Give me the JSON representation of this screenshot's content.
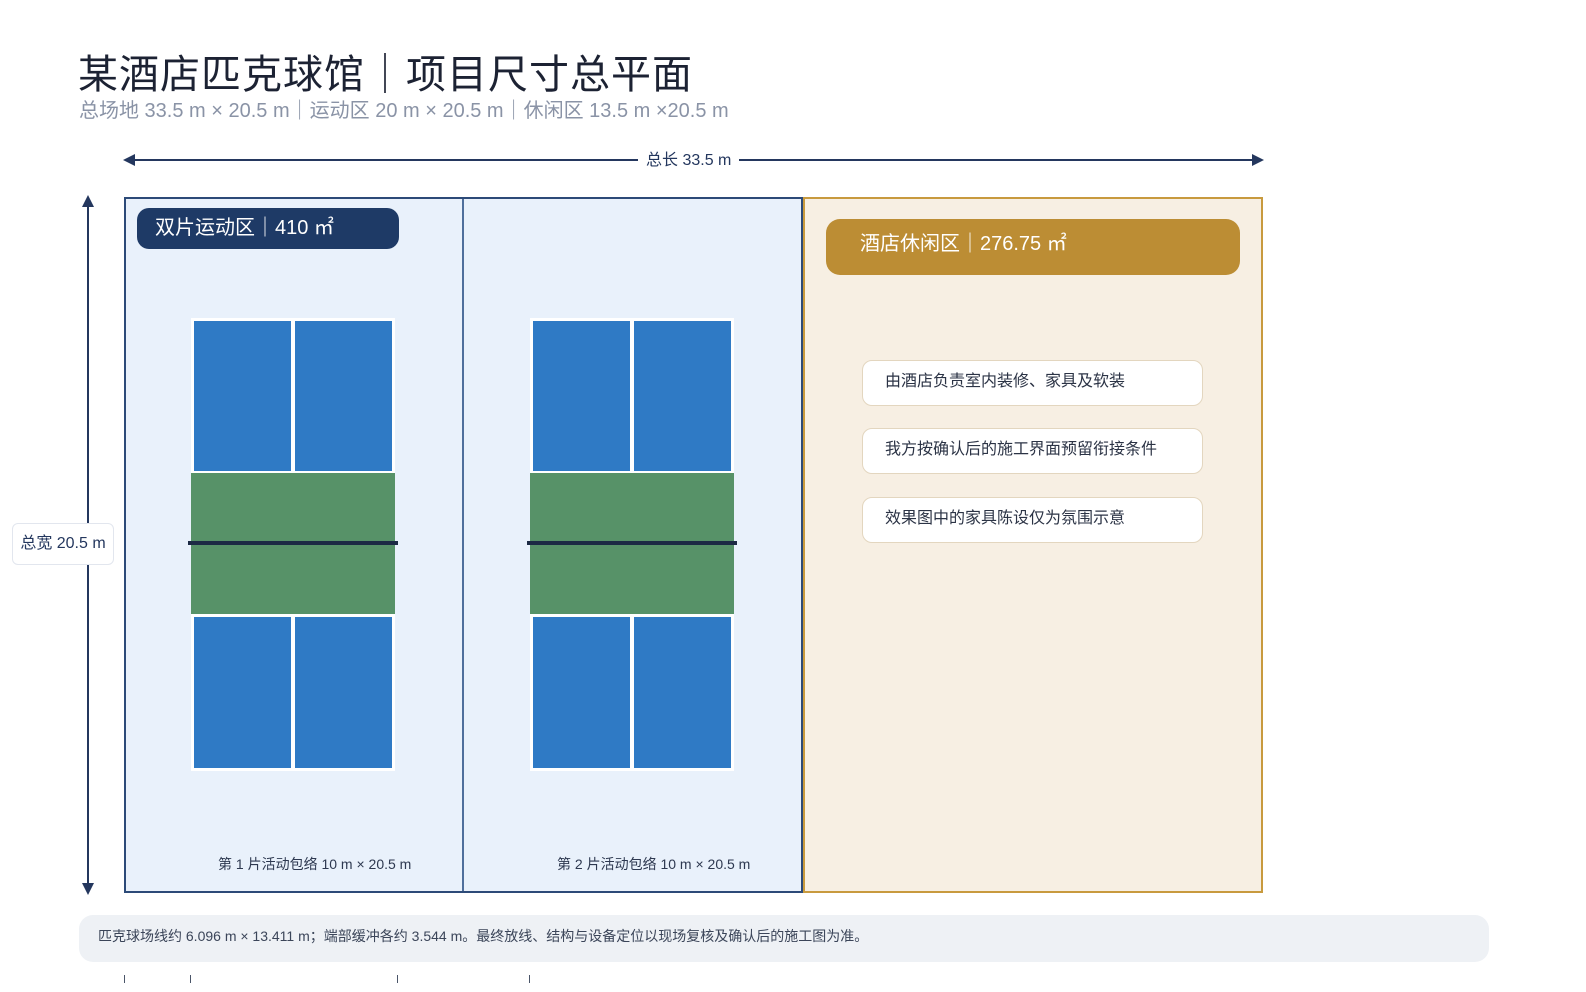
{
  "title": "某酒店匹克球馆｜项目尺寸总平面",
  "subtitle": "总场地 33.5 m × 20.5 m｜运动区 20 m × 20.5 m｜休闲区 13.5 m ×20.5 m",
  "dimensions": {
    "length_label": "总长 33.5 m",
    "width_label": "总宽 20.5 m"
  },
  "sport_zone": {
    "badge": "双片运动区｜410 ㎡",
    "courts": [
      {
        "label": "第 1 片活动包络 10 m × 20.5 m"
      },
      {
        "label": "第 2 片活动包络 10 m × 20.5 m"
      }
    ]
  },
  "leisure_zone": {
    "badge": "酒店休闲区｜276.75 ㎡",
    "notes": [
      "由酒店负责室内装修、家具及软装",
      "我方按确认后的施工界面预留衔接条件",
      "效果图中的家具陈设仅为氛围示意"
    ]
  },
  "footer_note": "匹克球场线约 6.096 m × 13.411 m；端部缓冲各约 3.544 m。最终放线、结构与设备定位以现场复核及确认后的施工图为准。",
  "colors": {
    "navy": "#1e3a66",
    "court_blue": "#2f7ac5",
    "kitchen_green": "#579268",
    "gold": "#bc8d34",
    "sport_bg": "#e9f1fb",
    "leisure_bg": "#f7efe3"
  }
}
